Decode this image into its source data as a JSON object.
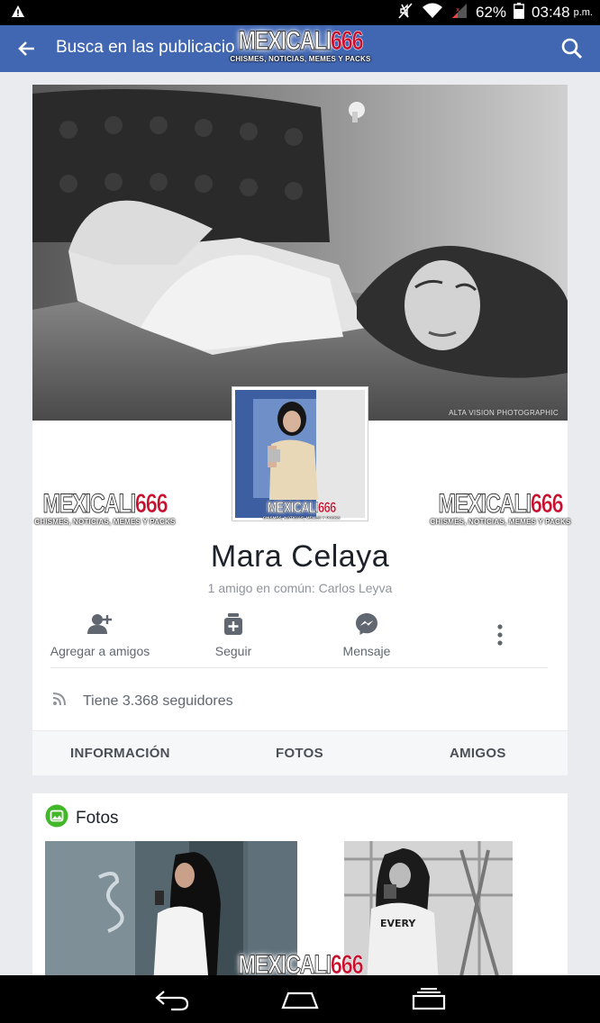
{
  "status_bar": {
    "battery": "62%",
    "time": "03:48",
    "ampm": "p.m.",
    "icons": [
      "warning-icon",
      "mute-icon",
      "wifi-icon",
      "signal-icon",
      "battery-icon"
    ]
  },
  "app_bar": {
    "search_query": "Busca en las publicaciones",
    "icons": [
      "back-arrow-icon",
      "search-icon"
    ]
  },
  "watermark": {
    "brand_prefix": "MEXICALI",
    "brand_number": "666",
    "tagline": "CHISMES, NOTICIAS, MEMES Y PACKS"
  },
  "profile": {
    "cover_credit": "ALTA VISION PHOTOGRAPHIC",
    "name": "Mara Celaya",
    "mutual_friends": "1 amigo en común: Carlos Leyva",
    "actions": [
      {
        "label": "Agregar a amigos",
        "icon": "add-friend-icon"
      },
      {
        "label": "Seguir",
        "icon": "follow-icon"
      },
      {
        "label": "Mensaje",
        "icon": "messenger-icon"
      }
    ],
    "followers": "Tiene 3.368 seguidores",
    "tabs": [
      "INFORMACIÓN",
      "FOTOS",
      "AMIGOS"
    ]
  },
  "photos_section": {
    "title": "Fotos"
  },
  "colors": {
    "facebook_blue": "#4267b2",
    "brand_red": "#c8102e",
    "photos_icon_green": "#42b72a",
    "background": "#e9ebee"
  }
}
